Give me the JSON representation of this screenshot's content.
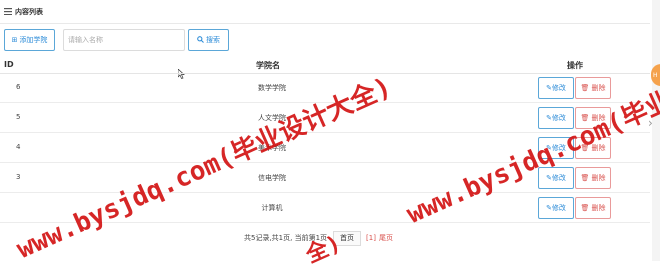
{
  "panel": {
    "title": "内容列表",
    "icon": "list-icon"
  },
  "toolbar": {
    "add_label": "添加学院",
    "add_icon": "add-icon",
    "search_placeholder": "请输入名称",
    "search_value": "",
    "search_label": "搜索",
    "search_icon": "search-icon"
  },
  "table": {
    "headers": {
      "id": "ID",
      "name": "学院名",
      "actions": "操作"
    },
    "edit_label": "✎修改",
    "delete_label": "🗑 删除",
    "rows": [
      {
        "id": "6",
        "name": "数学学院"
      },
      {
        "id": "5",
        "name": "人文学院"
      },
      {
        "id": "4",
        "name": "美术学院"
      },
      {
        "id": "3",
        "name": "信电学院"
      },
      {
        "id": "",
        "name": "计算机"
      }
    ]
  },
  "pager": {
    "summary": "共5记录,共1页, 当前第1页",
    "first_label": "首页",
    "current": "[1]",
    "last_label": "尾页"
  },
  "watermark": {
    "text1": "www.bysjdq.com(毕业设计大全)",
    "text2": "www.bysjdq.com(毕业设计大全)",
    "text3": "全)"
  },
  "side": {
    "float_label": "H"
  },
  "colors": {
    "primary": "#2d8cd8",
    "danger": "#d9534f",
    "watermark": "#d21414"
  }
}
